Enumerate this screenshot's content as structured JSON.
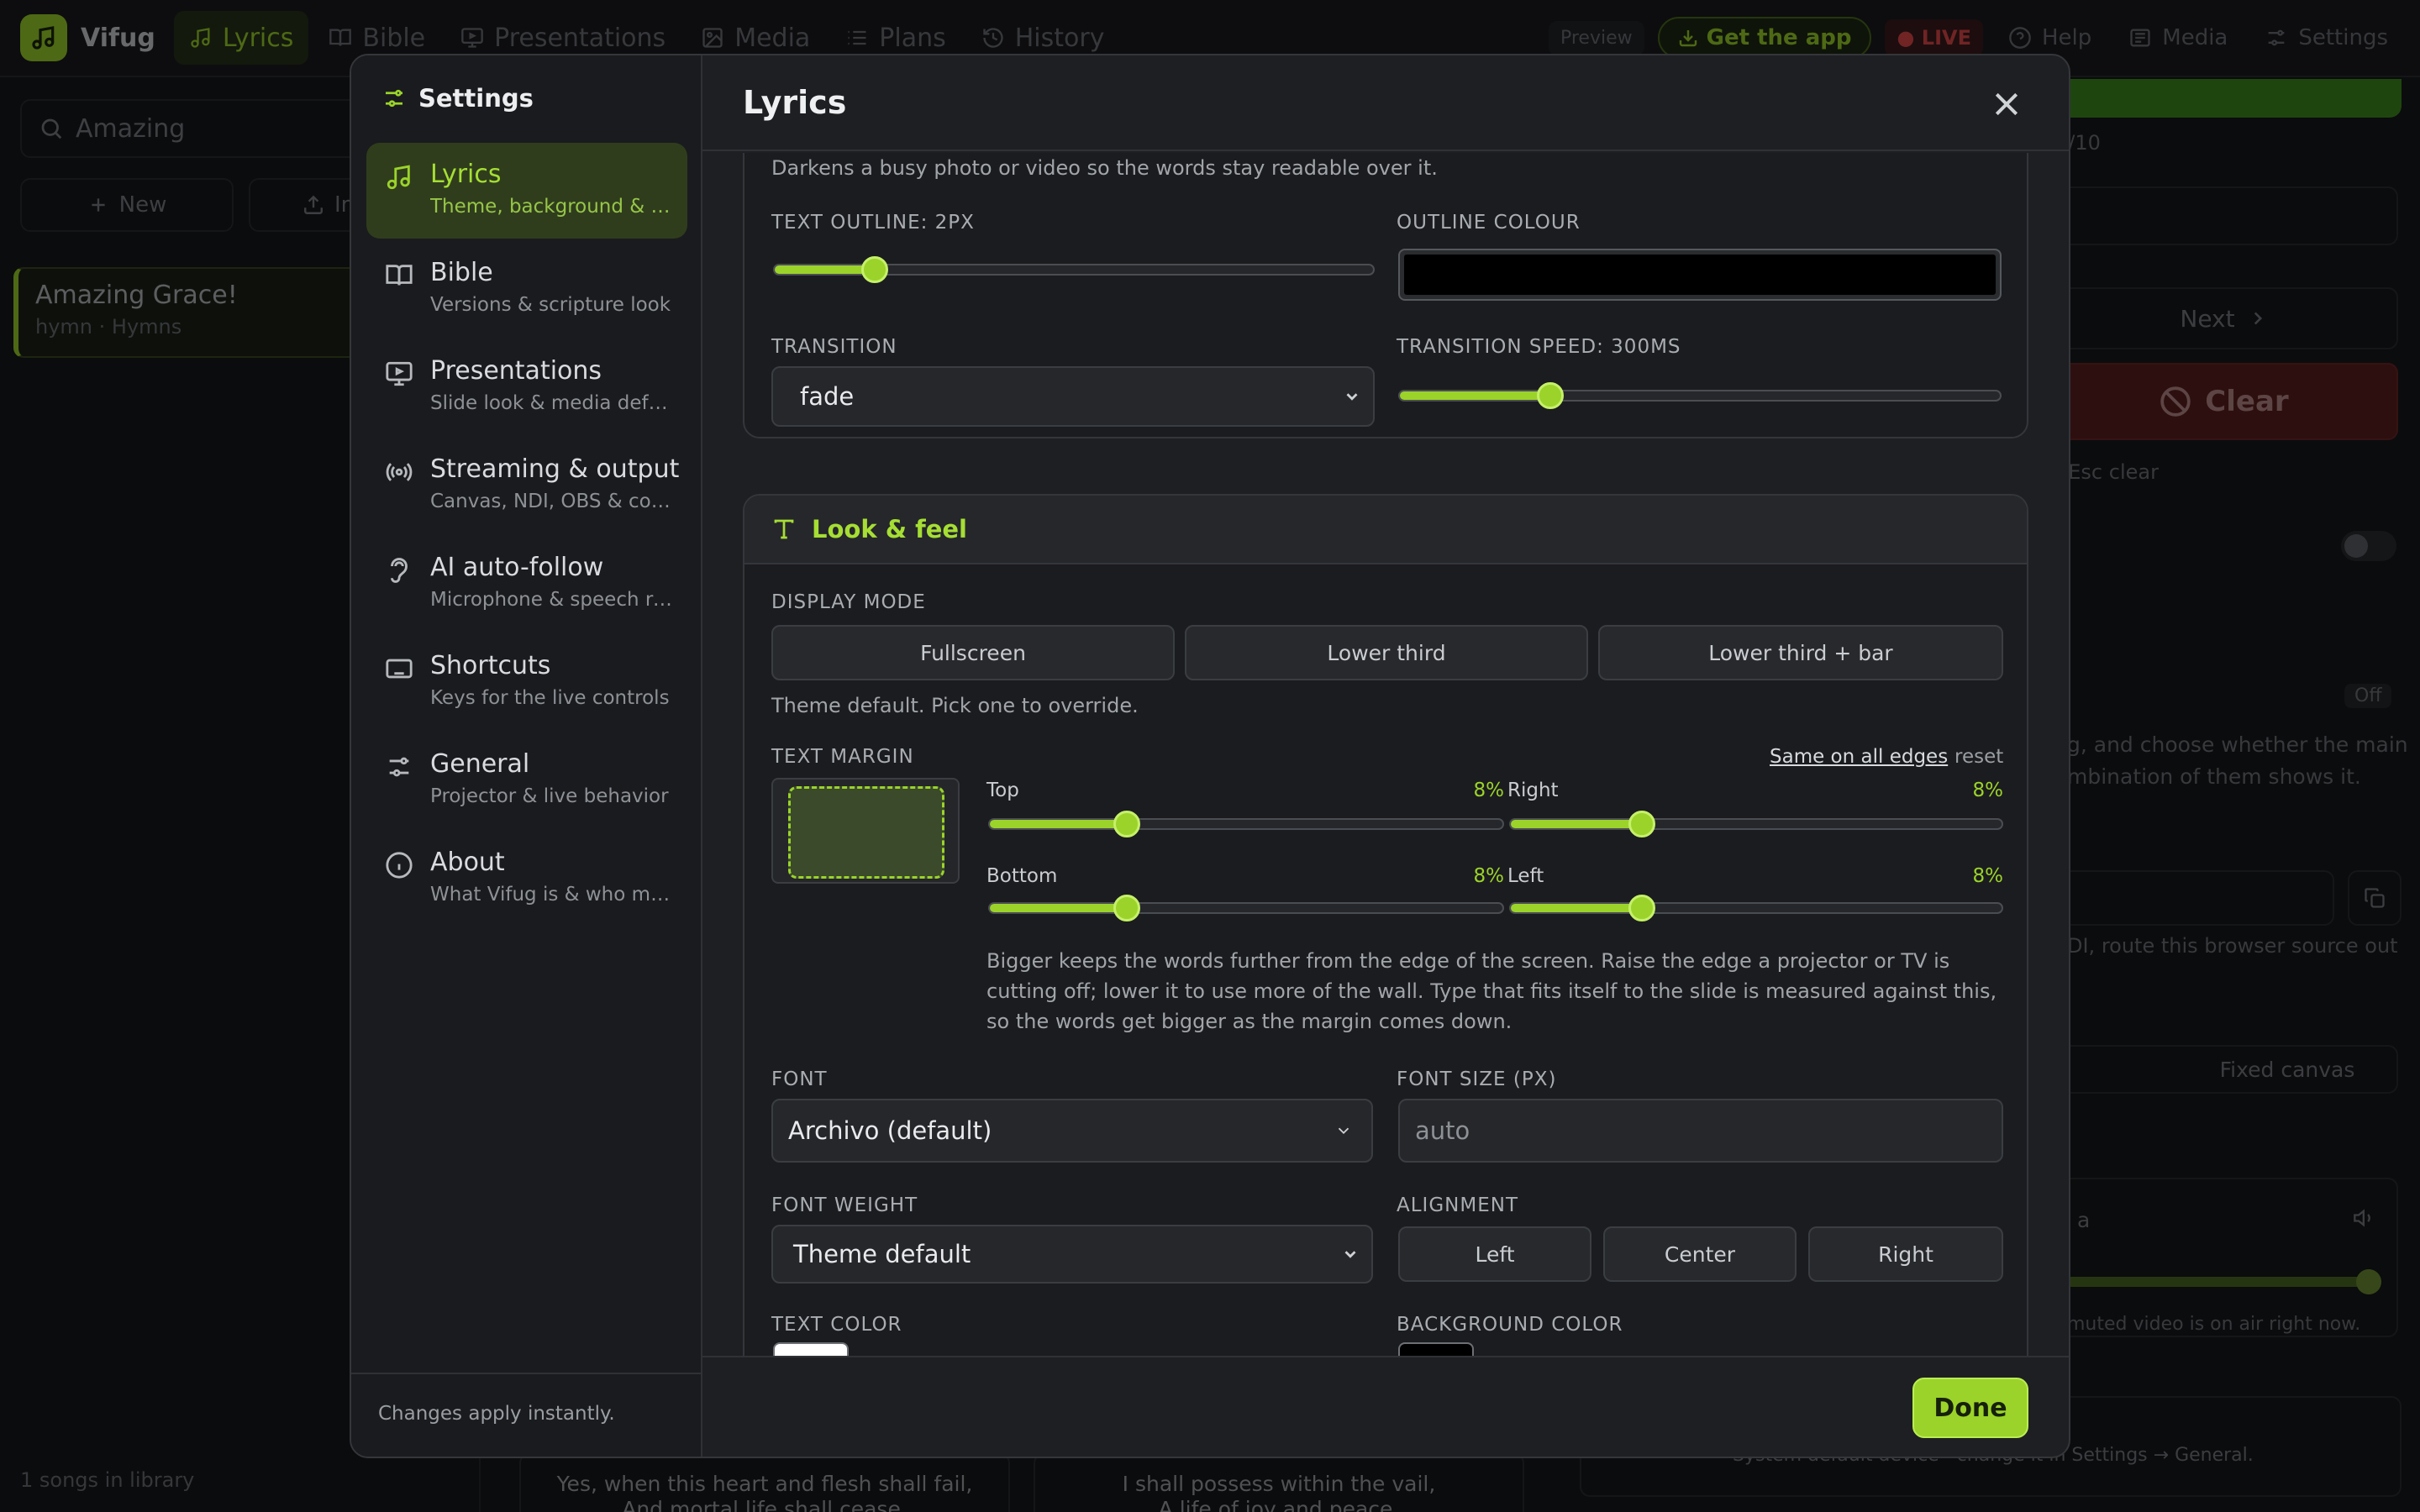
{
  "app": {
    "name": "Vifug",
    "nav": [
      {
        "label": "Lyrics",
        "icon": "music-note-icon",
        "active": true
      },
      {
        "label": "Bible",
        "icon": "book-icon",
        "active": false
      },
      {
        "label": "Presentations",
        "icon": "presentation-icon",
        "active": false
      },
      {
        "label": "Media",
        "icon": "image-icon",
        "active": false
      },
      {
        "label": "Plans",
        "icon": "list-icon",
        "active": false
      },
      {
        "label": "History",
        "icon": "history-icon",
        "active": false
      }
    ],
    "topbar": {
      "preview_badge": "Preview",
      "get_app": "Get the app",
      "live_badge": "LIVE",
      "help": "Help",
      "media": "Media",
      "settings": "Settings"
    },
    "library": {
      "search_value": "Amazing",
      "new_label": "New",
      "import_label": "Im",
      "song_title": "Amazing Grace!",
      "song_meta": "hymn · Hymns",
      "count_label": "1 songs in library"
    },
    "slides": [
      {
        "line1": "Yes, when this heart and flesh shall fail,",
        "line2": "And mortal life shall cease,"
      },
      {
        "line1": "I shall possess within the vail,",
        "line2": "A life of joy and peace."
      }
    ],
    "right_panel": {
      "counter": "1/10",
      "next_label": "Next",
      "clear_label": "Clear",
      "esc_hint": "· Esc clear",
      "off_badge": "Off",
      "desc1_line1": "g, and choose whether the main",
      "desc1_line2": "mbination of them shows it.",
      "ndi_hint": "DI, route this browser source out",
      "fixed_canvas": "Fixed canvas",
      "media_label": "a",
      "muted_hint": "muted video is on air right now.",
      "device_hint": "System default device · change it in Settings → General."
    }
  },
  "settings": {
    "title": "Settings",
    "footer_note": "Changes apply instantly.",
    "items": [
      {
        "title": "Lyrics",
        "sub": "Theme, background & fonts",
        "icon": "music-note-icon",
        "active": true
      },
      {
        "title": "Bible",
        "sub": "Versions & scripture look",
        "icon": "book-icon",
        "active": false
      },
      {
        "title": "Presentations",
        "sub": "Slide look & media defaults",
        "icon": "presentation-icon",
        "active": false
      },
      {
        "title": "Streaming & output",
        "sub": "Canvas, NDI, OBS & config",
        "icon": "broadcast-icon",
        "active": false
      },
      {
        "title": "AI auto-follow",
        "sub": "Microphone & speech recognition",
        "icon": "ear-icon",
        "active": false
      },
      {
        "title": "Shortcuts",
        "sub": "Keys for the live controls",
        "icon": "keyboard-icon",
        "active": false
      },
      {
        "title": "General",
        "sub": "Projector & live behavior",
        "icon": "sliders-icon",
        "active": false
      },
      {
        "title": "About",
        "sub": "What Vifug is & who made it",
        "icon": "info-icon",
        "active": false
      }
    ]
  },
  "lyrics_panel": {
    "title": "Lyrics",
    "done_label": "Done",
    "dim_help": "Darkens a busy photo or video so the words stay readable over it.",
    "text_outline": {
      "label": "TEXT OUTLINE: 2PX",
      "value": 2,
      "max": 12
    },
    "outline_colour": {
      "label": "OUTLINE COLOUR",
      "value": "#000000"
    },
    "transition": {
      "label": "TRANSITION",
      "value": "fade"
    },
    "transition_speed": {
      "label": "TRANSITION SPEED: 300MS",
      "value": 300,
      "max": 1200
    },
    "look_feel": {
      "title": "Look & feel",
      "display_mode_label": "DISPLAY MODE",
      "display_modes": [
        "Fullscreen",
        "Lower third",
        "Lower third + bar"
      ],
      "display_help": "Theme default. Pick one to override.",
      "text_margin_label": "TEXT MARGIN",
      "same_edges": "Same on all edges",
      "reset": "reset",
      "margins": [
        {
          "label": "Top",
          "pct": "8%",
          "value": 8,
          "max": 30
        },
        {
          "label": "Right",
          "pct": "8%",
          "value": 8,
          "max": 30
        },
        {
          "label": "Bottom",
          "pct": "8%",
          "value": 8,
          "max": 30
        },
        {
          "label": "Left",
          "pct": "8%",
          "value": 8,
          "max": 30
        }
      ],
      "margin_help_1": "Bigger keeps the words further from the edge of the screen. Raise the edge a projector or TV is",
      "margin_help_2": "cutting off; lower it to use more of the wall. Type that fits itself to the slide is measured against this,",
      "margin_help_3": "so the words get bigger as the margin comes down.",
      "font_label": "FONT",
      "font_value": "Archivo (default)",
      "font_size_label": "FONT SIZE (PX)",
      "font_size_placeholder": "auto",
      "font_weight_label": "FONT WEIGHT",
      "font_weight_value": "Theme default",
      "alignment_label": "ALIGNMENT",
      "alignments": [
        "Left",
        "Center",
        "Right"
      ],
      "text_color_label": "TEXT COLOR",
      "background_color_label": "BACKGROUND COLOR",
      "text_color": "#ffffff",
      "background_color": "#000000"
    }
  },
  "colors": {
    "accent": "#9bd32a",
    "danger": "#d83a3a"
  }
}
